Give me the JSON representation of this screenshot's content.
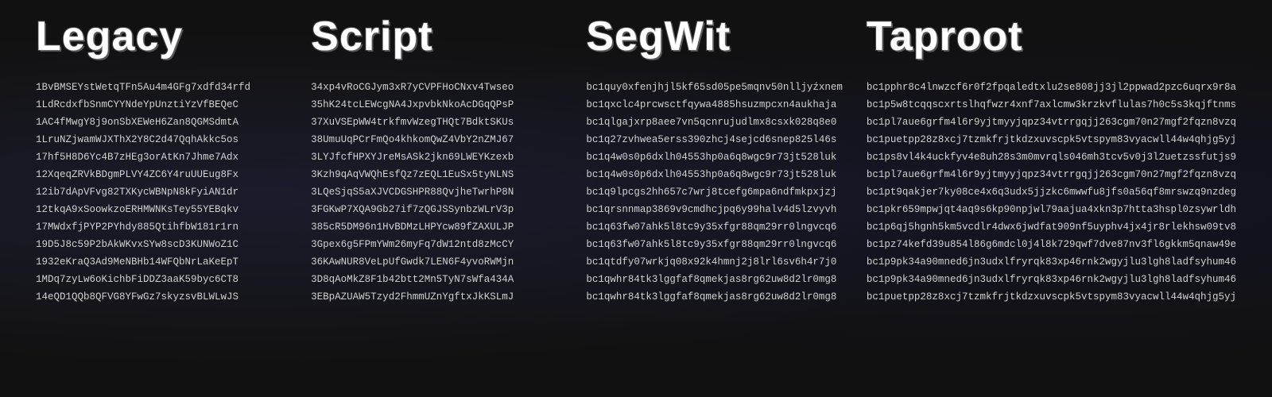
{
  "columns": [
    {
      "title": "Legacy",
      "id": "legacy",
      "addresses": [
        "1BvBMSEYstWetqTFn5Au4m4GFg7xdfd34rfd",
        "1LdRcdxfbSnmCYYNdeYpUnztiYzVfBEQeC",
        "1AC4fMwgY8j9onSbXEWeH6Zan8QGMSdmtA",
        "1LruNZjwamWJXThX2Y8C2d47QqhAkkc5os",
        "17hf5H8D6Yc4B7zHEg3orAtKn7Jhme7Adx",
        "12XqeqZRVkBDgmPLVY4ZC6Y4ruUUEug8Fx",
        "12ib7dApVFvg82TXKycWBNpN8kFyiAN1dr",
        "12tkqA9xSoowkzoERHMWNKsTey55YEBqkv",
        "17MWdxfjPYP2PYhdy885QtihfbW181r1rn",
        "19D5J8c59P2bAkWKvxSYw8scD3KUNWoZ1C",
        "1932eKraQ3Ad9MeNBHb14WFQbNrLaKeEpT",
        "1MDq7zyLw6oKichbFiDDZ3aaK59byc6CT8",
        "14eQD1QQb8QFVG8YFwGz7skyzsvBLWLwJS"
      ]
    },
    {
      "title": "Script",
      "id": "script",
      "addresses": [
        "34xp4vRoCGJym3xR7yCVPFHoCNxv4Twseo",
        "35hK24tcLEWcgNA4JxpvbkNkoAcDGqQPsP",
        "37XuVSEpWW4trkfmvWzegTHQt7BdktSKUs",
        "38UmuUqPCrFmQo4khkomQwZ4VbY2nZMJ67",
        "3LYJfcfHPXYJreMsASk2jkn69LWEYKzexb",
        "3Kzh9qAqVWQhEsfQz7zEQL1EuSx5tyNLNS",
        "3LQeSjqS5aXJVCDGSHPR88QvjheTwrhP8N",
        "3FGKwP7XQA9Gb27if7zQGJSSynbzWLrV3p",
        "385cR5DM96n1HvBDMzLHPYcw89fZAXULJP",
        "3Gpex6g5FPmYWm26myFq7dW12ntd8zMcCY",
        "36KAwNUR8VeLpUfGwdk7LEN6F4yvoRWMjn",
        "3D8qAoMkZ8F1b42btt2Mn5TyN7sWfa434A",
        "3EBpAZUAW5Tzyd2FhmmUZnYgftxJkKSLmJ"
      ]
    },
    {
      "title": "SegWit",
      "id": "segwit",
      "addresses": [
        "bc1quy0xfenjhjl5kf65sd05pe5mqnv50nlljyźxnem",
        "bc1qxclc4prcwsctfqywa4885hsuzmpcxn4aukhaja",
        "bc1qlgajxrp8aee7vn5qcnrujudlmx8csxk028q8e0",
        "bc1q27zvhwea5erss390zhcj4sejcd6snep825l46s",
        "bc1q4w0s0p6dxlh04553hp0a6q8wgc9r73jt528luk",
        "bc1q4w0s0p6dxlh04553hp0a6q8wgc9r73jt528luk",
        "bc1q9lpcgs2hh657c7wrj8tcefg6mpa6ndfmkpxjzj",
        "bc1qrsnnmap3869v9cmdhcjpq6y99halv4d5lzvyvh",
        "bc1q63fw07ahk5l8tc9y35xfgr88qm29rr0lngvcq6",
        "bc1q63fw07ahk5l8tc9y35xfgr88qm29rr0lngvcq6",
        "bc1qtdfy07wrkjq08x92k4hmnj2j8lrl6sv6h4r7j0",
        "bc1qwhr84tk3lggfaf8qmekjas8rg62uw8d2lr0mg8",
        "bc1qwhr84tk3lggfaf8qmekjas8rg62uw8d2lr0mg8"
      ]
    },
    {
      "title": "Taproot",
      "id": "taproot",
      "addresses": [
        "bc1pphr8c4lnwzcf6r0f2fpqaledtxlu2se808jj3jl2ppwad2pzc6uqrx9r8a",
        "bc1p5w8tcqqscxrtslhqfwzr4xnf7axlcmw3krzkvflulas7h0c5s3kqjftnms",
        "bc1pl7aue6grfm4l6r9yjtmyyjqpz34vtrrgqjj263cgm70n27mgf2fqzn8vzq",
        "bc1puetpp28z8xcj7tzmkfrjtkdzxuvscpk5vtspym83vyacwll44w4qhjg5yj",
        "bc1ps8vl4k4uckfyv4e8uh28s3m0mvrqls046mh3tcv5v0j3l2uetzssfutjs9",
        "bc1pl7aue6grfm4l6r9yjtmyyjqpz34vtrrgqjj263cgm70n27mgf2fqzn8vzq",
        "bc1pt9qakjer7ky08ce4x6q3udx5jjzkc6mwwfu8jfs0a56qf8mrswzq9nzdeg",
        "bc1pkr659mpwjqt4aq9s6kp90npjwl79aajua4xkn3p7htta3hspl0zsywrldh",
        "bc1p6qj5hgnh5km5vcdlr4dwx6jwdfat909nf5uyphv4jx4jr8rlekhsw09tv8",
        "bc1pz74kefd39u854l86g6mdcl0j4l8k729qwf7dve87nv3fl6gkkm5qnaw49e",
        "bc1p9pk34a90mned6jn3udxlfryrqk83xp46rnk2wgyjlu3lgh8ladfsyhum46",
        "bc1p9pk34a90mned6jn3udxlfryrqk83xp46rnk2wgyjlu3lgh8ladfsyhum46",
        "bc1puetpp28z8xcj7tzmkfrjtkdzxuvscpk5vtspym83vyacwll44w4qhjg5yj"
      ]
    }
  ]
}
